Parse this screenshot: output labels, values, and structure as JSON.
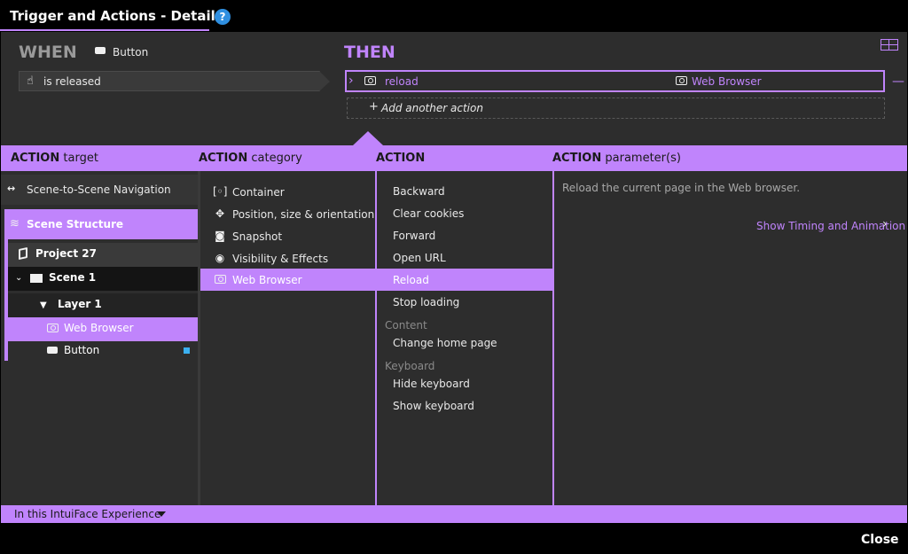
{
  "window": {
    "title": "Trigger and Actions - Details",
    "help_label": "?"
  },
  "when": {
    "label": "WHEN",
    "object": "Button",
    "trigger": "is released"
  },
  "then": {
    "label": "THEN",
    "action": {
      "name": "reload",
      "target": "Web Browser"
    },
    "remove_label": "—",
    "add_action": "Add another action",
    "add_plus": "+"
  },
  "columns": {
    "target": {
      "bold": "ACTION",
      "rest": "target"
    },
    "category": {
      "bold": "ACTION",
      "rest": "category"
    },
    "action": {
      "bold": "ACTION",
      "rest": ""
    },
    "parameters": {
      "bold": "ACTION",
      "rest": "parameter(s)"
    }
  },
  "targets": {
    "nav_item": "Scene-to-Scene Navigation",
    "structure": "Scene Structure",
    "tree": {
      "project": "Project 27",
      "scene": "Scene 1",
      "layer": "Layer 1",
      "web_browser": "Web Browser",
      "button": "Button"
    }
  },
  "categories": [
    {
      "label": "Container",
      "icon": "container-icon",
      "glyph": "[◦]"
    },
    {
      "label": "Position, size & orientation",
      "icon": "move-icon",
      "glyph": "✥"
    },
    {
      "label": "Snapshot",
      "icon": "camera-icon",
      "glyph": "◙"
    },
    {
      "label": "Visibility & Effects",
      "icon": "eye-icon",
      "glyph": "◉"
    },
    {
      "label": "Web Browser",
      "icon": "web-browser-icon",
      "glyph": ""
    }
  ],
  "actions": {
    "main": [
      "Backward",
      "Clear cookies",
      "Forward",
      "Open URL",
      "Reload",
      "Stop loading"
    ],
    "content_group": "Content",
    "content": [
      "Change home page"
    ],
    "keyboard_group": "Keyboard",
    "keyboard": [
      "Hide keyboard",
      "Show keyboard"
    ]
  },
  "parameters": {
    "description": "Reload the current page in the Web browser.",
    "show_timing": "Show Timing and Animation"
  },
  "footer": {
    "scope": "In this IntuiFace Experience",
    "close": "Close"
  },
  "colors": {
    "accent": "#c084fc",
    "help": "#2f8fe0",
    "indicator": "#3bb0f0"
  }
}
